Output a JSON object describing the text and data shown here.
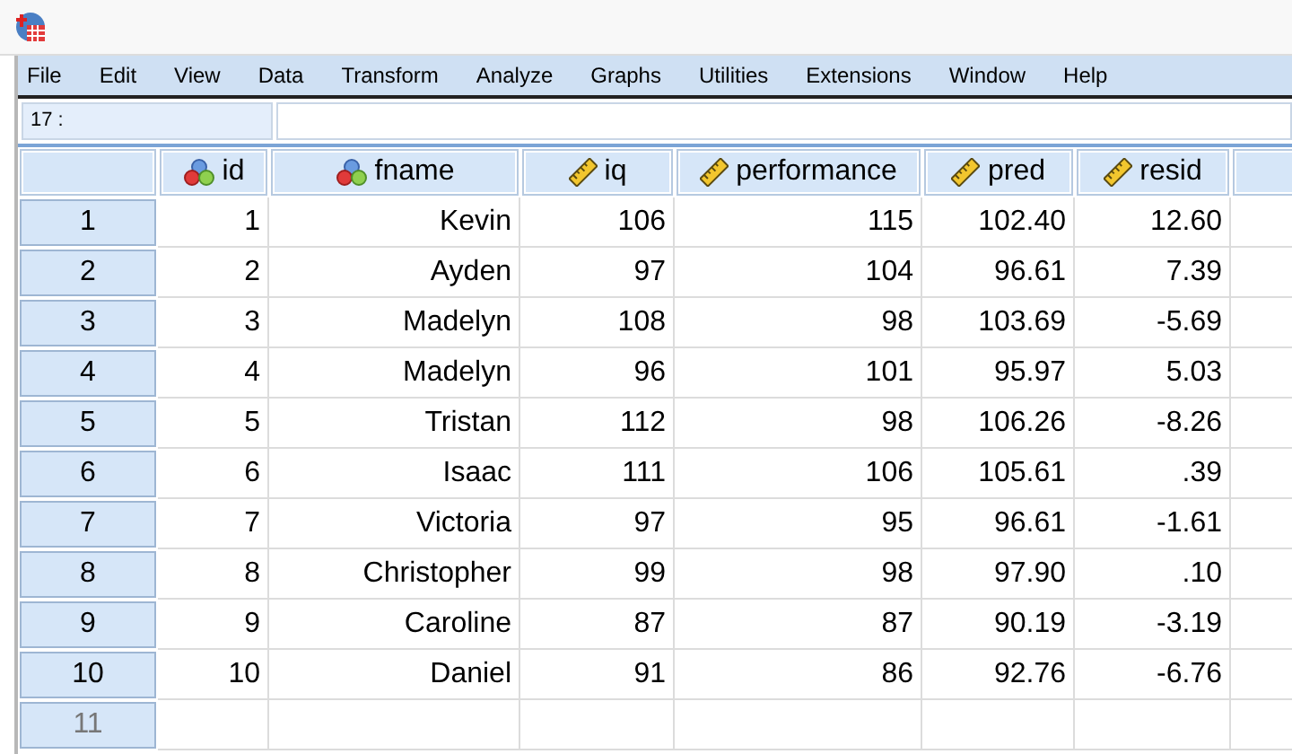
{
  "menu": [
    "File",
    "Edit",
    "View",
    "Data",
    "Transform",
    "Analyze",
    "Graphs",
    "Utilities",
    "Extensions",
    "Window",
    "Help"
  ],
  "cell_editor": {
    "reference": "17 :"
  },
  "columns": [
    {
      "name": "id",
      "kind": "nominal"
    },
    {
      "name": "fname",
      "kind": "nominal"
    },
    {
      "name": "iq",
      "kind": "scale"
    },
    {
      "name": "performance",
      "kind": "scale"
    },
    {
      "name": "pred",
      "kind": "scale"
    },
    {
      "name": "resid",
      "kind": "scale"
    }
  ],
  "rows": [
    {
      "number": "1",
      "kind": "data",
      "cells": [
        "1",
        "Kevin",
        "106",
        "115",
        "102.40",
        "12.60"
      ]
    },
    {
      "number": "2",
      "kind": "data",
      "cells": [
        "2",
        "Ayden",
        "97",
        "104",
        "96.61",
        "7.39"
      ]
    },
    {
      "number": "3",
      "kind": "data",
      "cells": [
        "3",
        "Madelyn",
        "108",
        "98",
        "103.69",
        "-5.69"
      ]
    },
    {
      "number": "4",
      "kind": "data",
      "cells": [
        "4",
        "Madelyn",
        "96",
        "101",
        "95.97",
        "5.03"
      ]
    },
    {
      "number": "5",
      "kind": "data",
      "cells": [
        "5",
        "Tristan",
        "112",
        "98",
        "106.26",
        "-8.26"
      ]
    },
    {
      "number": "6",
      "kind": "data",
      "cells": [
        "6",
        "Isaac",
        "111",
        "106",
        "105.61",
        ".39"
      ]
    },
    {
      "number": "7",
      "kind": "data",
      "cells": [
        "7",
        "Victoria",
        "97",
        "95",
        "96.61",
        "-1.61"
      ]
    },
    {
      "number": "8",
      "kind": "data",
      "cells": [
        "8",
        "Christopher",
        "99",
        "98",
        "97.90",
        ".10"
      ]
    },
    {
      "number": "9",
      "kind": "data",
      "cells": [
        "9",
        "Caroline",
        "87",
        "87",
        "90.19",
        "-3.19"
      ]
    },
    {
      "number": "10",
      "kind": "data",
      "cells": [
        "10",
        "Daniel",
        "91",
        "86",
        "92.76",
        "-6.76"
      ]
    },
    {
      "number": "11",
      "kind": "blank"
    }
  ]
}
